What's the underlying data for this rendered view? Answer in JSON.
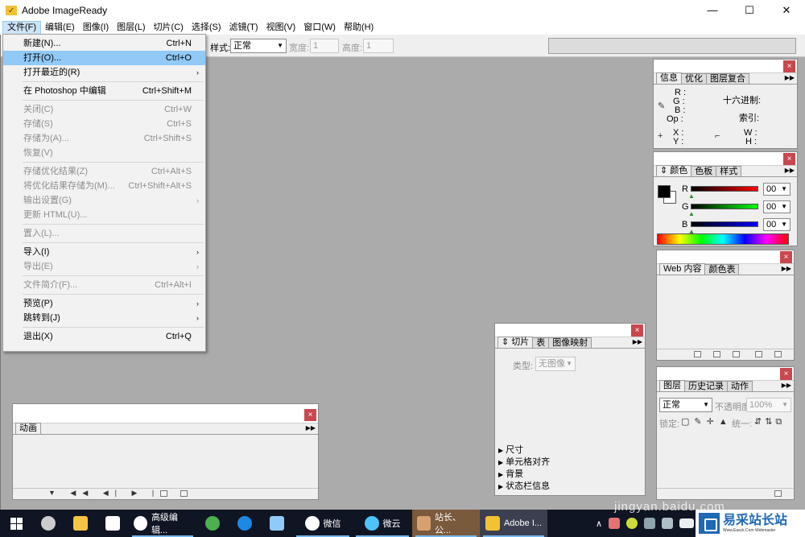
{
  "window": {
    "title": "Adobe ImageReady",
    "minimize": "—",
    "maximize": "☐",
    "close": "✕"
  },
  "menubar": [
    "文件(F)",
    "编辑(E)",
    "图像(I)",
    "图层(L)",
    "切片(C)",
    "选择(S)",
    "滤镜(T)",
    "视图(V)",
    "窗口(W)",
    "帮助(H)"
  ],
  "options": {
    "style_label": "样式:",
    "style_value": "正常",
    "width_label": "宽度:",
    "width_value": "1",
    "height_label": "高度:",
    "height_value": "1"
  },
  "file_menu": {
    "new": {
      "label": "新建(N)...",
      "shortcut": "Ctrl+N"
    },
    "open": {
      "label": "打开(O)...",
      "shortcut": "Ctrl+O"
    },
    "open_recent": {
      "label": "打开最近的(R)"
    },
    "edit_in_ps": {
      "label": "在 Photoshop 中编辑",
      "shortcut": "Ctrl+Shift+M"
    },
    "close": {
      "label": "关闭(C)",
      "shortcut": "Ctrl+W"
    },
    "save": {
      "label": "存储(S)",
      "shortcut": "Ctrl+S"
    },
    "save_as": {
      "label": "存储为(A)...",
      "shortcut": "Ctrl+Shift+S"
    },
    "revert": {
      "label": "恢复(V)"
    },
    "save_optimized": {
      "label": "存储优化结果(Z)",
      "shortcut": "Ctrl+Alt+S"
    },
    "save_optimized_as": {
      "label": "将优化结果存储为(M)...",
      "shortcut": "Ctrl+Shift+Alt+S"
    },
    "output_settings": {
      "label": "输出设置(G)"
    },
    "update_html": {
      "label": "更新 HTML(U)..."
    },
    "place": {
      "label": "置入(L)..."
    },
    "import": {
      "label": "导入(I)"
    },
    "export": {
      "label": "导出(E)"
    },
    "file_info": {
      "label": "文件简介(F)...",
      "shortcut": "Ctrl+Alt+I"
    },
    "preview": {
      "label": "预览(P)"
    },
    "jump_to": {
      "label": "跳转到(J)"
    },
    "exit": {
      "label": "退出(X)",
      "shortcut": "Ctrl+Q"
    }
  },
  "info_panel": {
    "tabs": [
      "信息",
      "优化",
      "图层复合"
    ],
    "r": "R :",
    "g": "G :",
    "b": "B :",
    "op": "Op :",
    "hex": "十六进制:",
    "index": "索引:",
    "x": "X :",
    "y": "Y :",
    "w": "W :",
    "h": "H :"
  },
  "color_panel": {
    "tabs": [
      "颜色",
      "色板",
      "样式"
    ],
    "r": "R",
    "g": "G",
    "b": "B",
    "r_val": "00",
    "g_val": "00",
    "b_val": "00"
  },
  "web_panel": {
    "tabs": [
      "Web 内容",
      "颜色表"
    ]
  },
  "layers_panel": {
    "tabs": [
      "图层",
      "历史记录",
      "动作"
    ],
    "blend": "正常",
    "opacity_label": "不透明度:",
    "opacity_value": "100%",
    "lock_label": "锁定:",
    "unify_label": "统一:"
  },
  "slice_panel": {
    "tabs": [
      "切片",
      "表",
      "图像映射"
    ],
    "type_label": "类型:",
    "type_value": "无图像",
    "sections": [
      "尺寸",
      "单元格对齐",
      "背景",
      "状态栏信息"
    ]
  },
  "animation_panel": {
    "tabs": [
      "动画"
    ]
  },
  "taskbar": {
    "apps": [
      "高级编辑...",
      "微信",
      "微云",
      "站长、公...",
      "Adobe I..."
    ],
    "colors": {
      "bg": "#101523",
      "accent": "#76b9ed"
    }
  },
  "watermark": "jingyan.baidu.com",
  "brand": {
    "name": "易采站长站",
    "sub": "Www.Easck.Com Webmaster"
  }
}
